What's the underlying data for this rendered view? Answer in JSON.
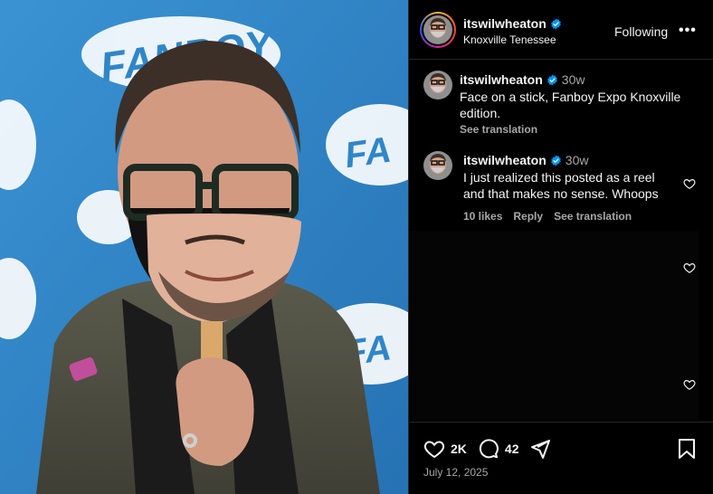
{
  "post": {
    "username": "itswilwheaton",
    "location": "Knoxville Tenessee",
    "follow_label": "Following",
    "more_label": "•••",
    "photo_backdrop_text": "FANBOY",
    "date": "July 12, 2025"
  },
  "caption": {
    "username": "itswilwheaton",
    "time": "30w",
    "text_line1": "Face on a stick, Fanboy Expo Knoxville",
    "text_line2": "edition.",
    "see_translation": "See translation"
  },
  "comments": [
    {
      "username": "itswilwheaton",
      "time": "30w",
      "text_line1": "I just realized this posted as a reel",
      "text_line2": "and that makes no sense. Whoops",
      "likes": "10 likes",
      "reply": "Reply",
      "see_translation": "See translation"
    }
  ],
  "actions": {
    "likes_count": "2K",
    "comments_count": "42"
  },
  "colors": {
    "backdrop_blue": "#2f86c8",
    "verified_blue": "#0095f6",
    "muted_text": "#a8a8a8"
  },
  "icons": [
    "verified-badge-icon",
    "more-icon",
    "heart-icon",
    "comment-icon",
    "share-icon",
    "bookmark-icon"
  ]
}
